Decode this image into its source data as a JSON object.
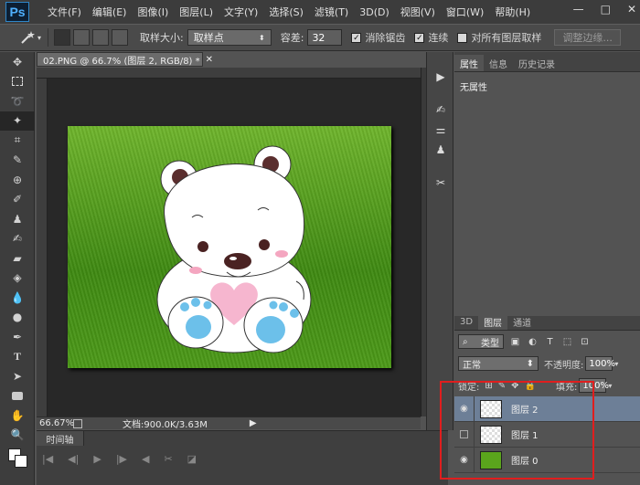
{
  "app": {
    "logo": "Ps",
    "menu": [
      "文件(F)",
      "编辑(E)",
      "图像(I)",
      "图层(L)",
      "文字(Y)",
      "选择(S)",
      "滤镜(T)",
      "3D(D)",
      "视图(V)",
      "窗口(W)",
      "帮助(H)"
    ],
    "window_controls": {
      "minimize": "—",
      "restore": "□",
      "close": "✕"
    }
  },
  "options_bar": {
    "sample_size_label": "取样大小:",
    "sample_size_value": "取样点",
    "tolerance_label": "容差:",
    "tolerance_value": "32",
    "anti_alias_label": "消除锯齿",
    "contiguous_label": "连续",
    "all_layers_label": "对所有图层取样",
    "refine_edge_label": "调整边缘..."
  },
  "document": {
    "tab_title": "02.PNG @ 66.7% (图层 2, RGB/8) *",
    "zoom": "66.67%",
    "doc_info": "文档:900.0K/3.63M"
  },
  "timeline": {
    "tab": "时间轴"
  },
  "properties_panel": {
    "tabs": [
      "属性",
      "信息",
      "历史记录"
    ],
    "body_text": "无属性"
  },
  "layers_panel": {
    "tabs": [
      "3D",
      "图层",
      "通道"
    ],
    "filter_type": "类型",
    "blend_mode": "正常",
    "opacity_label": "不透明度:",
    "opacity_value": "100%",
    "lock_label": "锁定:",
    "fill_label": "填充:",
    "fill_value": "100%",
    "layers": [
      {
        "name": "图层 2",
        "visible": true,
        "selected": true
      },
      {
        "name": "图层 1",
        "visible": false,
        "selected": false
      },
      {
        "name": "图层 0",
        "visible": true,
        "selected": false
      }
    ]
  },
  "colors": {
    "highlight": "#e01e1e",
    "selected_layer": "#6d7f97",
    "grass": "#4c9a18"
  }
}
